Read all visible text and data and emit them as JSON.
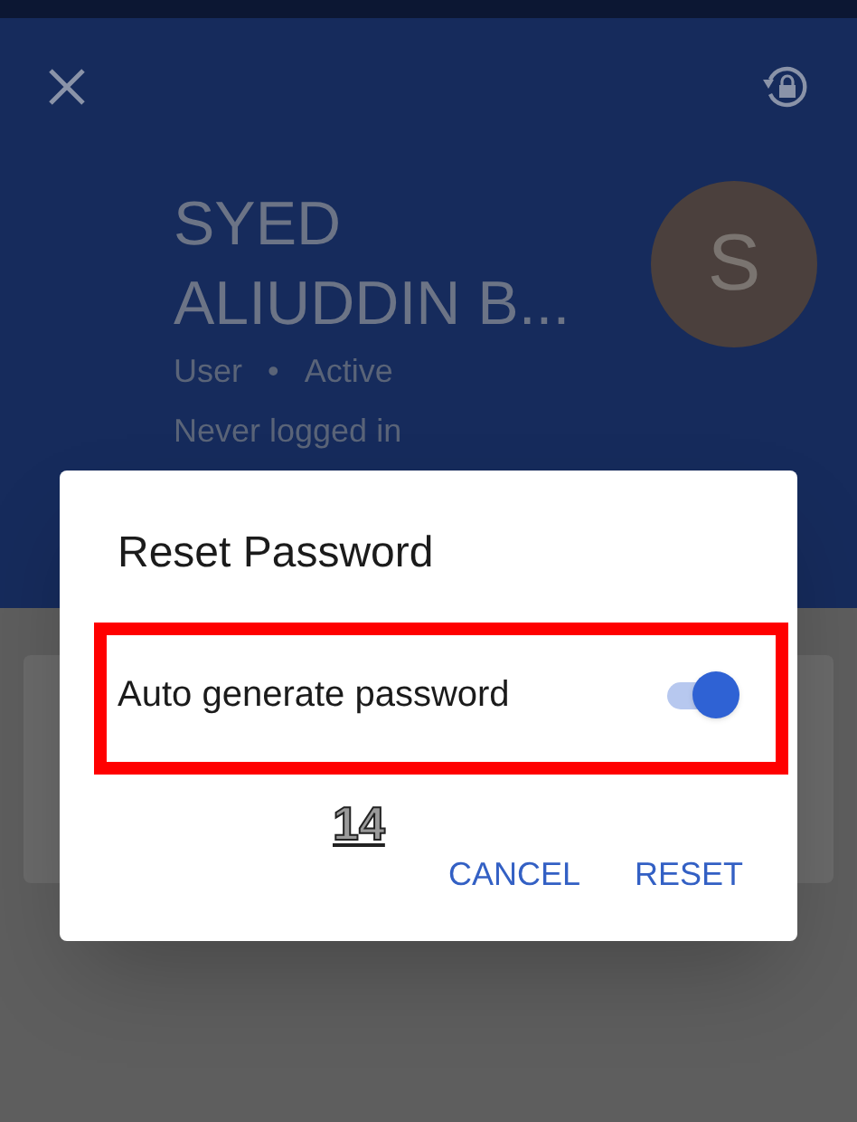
{
  "header": {
    "name": "SYED ALIUDDIN B...",
    "avatar_initial": "S",
    "role": "User",
    "separator": "•",
    "status": "Active",
    "last_login": "Never logged in"
  },
  "dialog": {
    "title": "Reset Password",
    "option": {
      "label": "Auto generate password",
      "on": true
    },
    "annotation": "14",
    "buttons": [
      "CANCEL",
      "RESET"
    ]
  }
}
